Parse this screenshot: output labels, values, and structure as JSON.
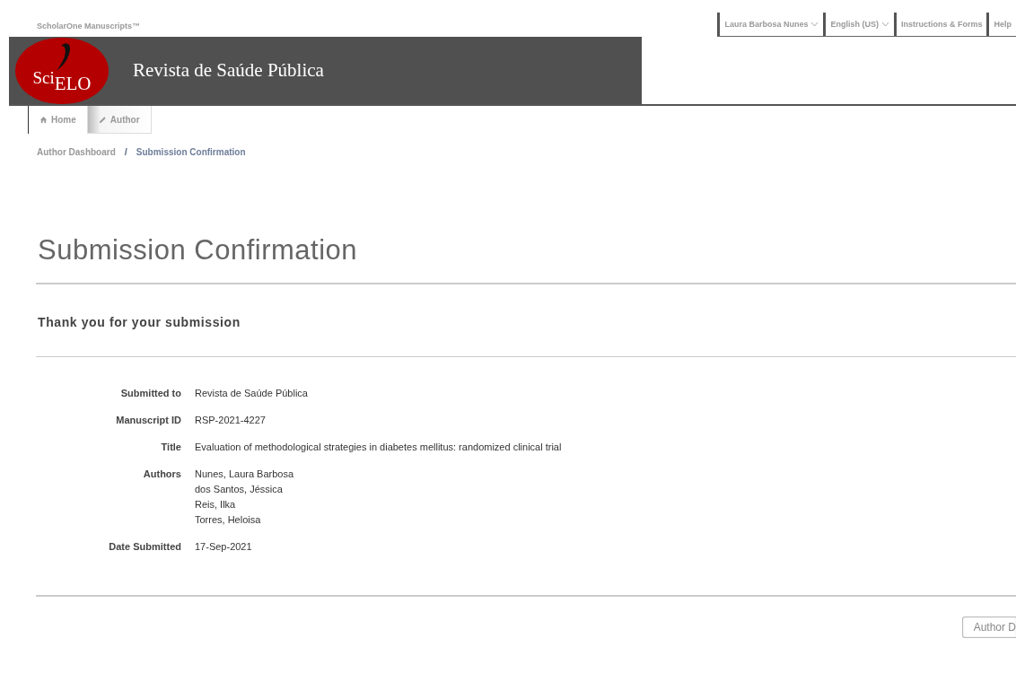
{
  "brand": "ScholarOne Manuscripts™",
  "top_links": [
    {
      "label": "Laura Barbosa Nunes",
      "dropdown": true
    },
    {
      "label": "English (US)",
      "dropdown": true
    },
    {
      "label": "Instructions & Forms",
      "dropdown": false
    },
    {
      "label": "Help",
      "dropdown": false
    }
  ],
  "logo": {
    "part_1": "Sci",
    "part_2": "ELO"
  },
  "journal_title": "Revista de Saúde Pública",
  "tabs": [
    {
      "label": "Home",
      "selected": true
    },
    {
      "label": "Author",
      "selected": false
    }
  ],
  "breadcrumb": [
    "Author Dashboard",
    "Submission Confirmation"
  ],
  "breadcrumb_separator": "/",
  "page_title": "Submission Confirmation",
  "subtitle": "Thank you for your submission",
  "details": [
    {
      "label": "Submitted to",
      "values": [
        "Revista de Saúde Pública"
      ]
    },
    {
      "label": "Manuscript ID",
      "values": [
        "RSP-2021-4227"
      ]
    },
    {
      "label": "Title",
      "values": [
        "Evaluation of methodological strategies in diabetes mellitus: randomized clinical trial"
      ]
    },
    {
      "label": "Authors",
      "values": [
        "Nunes, Laura Barbosa",
        "dos Santos, Jéssica",
        "Reis, Ilka",
        "Torres, Heloisa"
      ]
    },
    {
      "label": "Date Submitted",
      "values": [
        "17-Sep-2021"
      ]
    }
  ],
  "footer_button": "Author D"
}
